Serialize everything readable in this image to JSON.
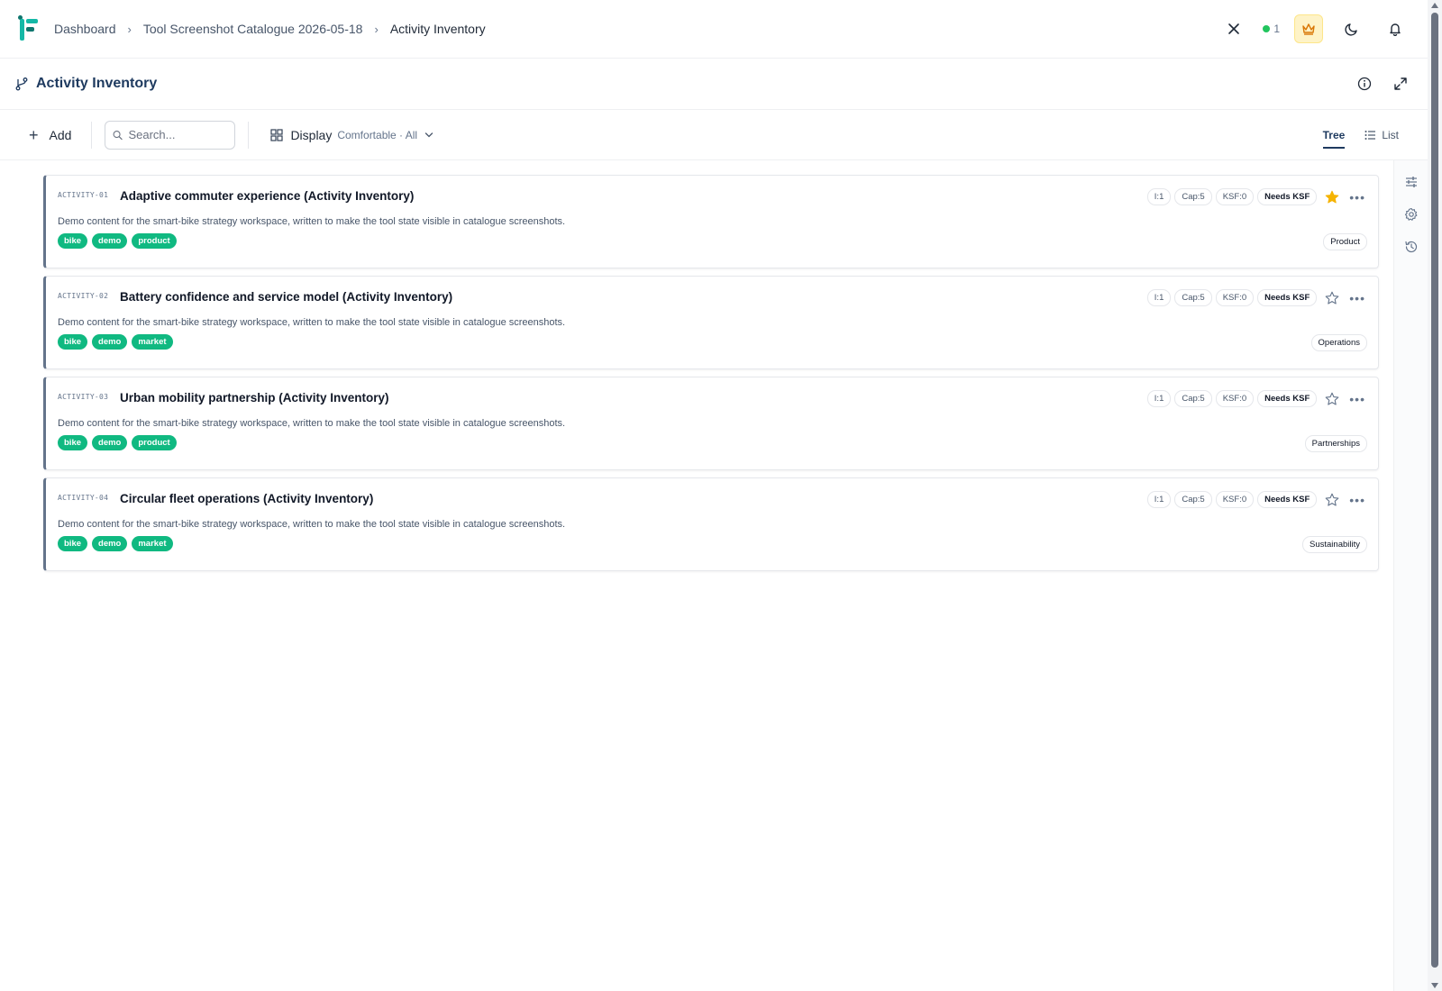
{
  "breadcrumb": {
    "items": [
      "Dashboard",
      "Tool Screenshot Catalogue 2026-05-18",
      "Activity Inventory"
    ]
  },
  "header": {
    "status_count": "1",
    "icons": [
      "close-icon",
      "crown-icon",
      "moon-icon",
      "bell-icon"
    ]
  },
  "page": {
    "title": "Activity Inventory"
  },
  "toolbar": {
    "add_label": "Add",
    "search_placeholder": "Search...",
    "display_label": "Display",
    "display_sub": "Comfortable · All",
    "tabs": [
      "Tree",
      "List"
    ],
    "active_tab": "Tree"
  },
  "colors": {
    "accent": "#1e3a5f",
    "tag": "#10b981",
    "star_active": "#f5b301"
  },
  "activities": [
    {
      "code": "ACTIVITY-01",
      "title": "Adaptive commuter experience (Activity Inventory)",
      "description": "Demo content for the smart-bike strategy workspace, written to make the tool state visible in catalogue screenshots.",
      "tags": [
        "bike",
        "demo",
        "product"
      ],
      "chips": [
        "I:1",
        "Cap:5",
        "KSF:0",
        "Needs KSF"
      ],
      "starred": true,
      "category": "Product"
    },
    {
      "code": "ACTIVITY-02",
      "title": "Battery confidence and service model (Activity Inventory)",
      "description": "Demo content for the smart-bike strategy workspace, written to make the tool state visible in catalogue screenshots.",
      "tags": [
        "bike",
        "demo",
        "market"
      ],
      "chips": [
        "I:1",
        "Cap:5",
        "KSF:0",
        "Needs KSF"
      ],
      "starred": false,
      "category": "Operations"
    },
    {
      "code": "ACTIVITY-03",
      "title": "Urban mobility partnership (Activity Inventory)",
      "description": "Demo content for the smart-bike strategy workspace, written to make the tool state visible in catalogue screenshots.",
      "tags": [
        "bike",
        "demo",
        "product"
      ],
      "chips": [
        "I:1",
        "Cap:5",
        "KSF:0",
        "Needs KSF"
      ],
      "starred": false,
      "category": "Partnerships"
    },
    {
      "code": "ACTIVITY-04",
      "title": "Circular fleet operations (Activity Inventory)",
      "description": "Demo content for the smart-bike strategy workspace, written to make the tool state visible in catalogue screenshots.",
      "tags": [
        "bike",
        "demo",
        "market"
      ],
      "chips": [
        "I:1",
        "Cap:5",
        "KSF:0",
        "Needs KSF"
      ],
      "starred": false,
      "category": "Sustainability"
    }
  ],
  "rail": {
    "icons": [
      "sliders-icon",
      "gear-icon",
      "history-icon"
    ]
  }
}
